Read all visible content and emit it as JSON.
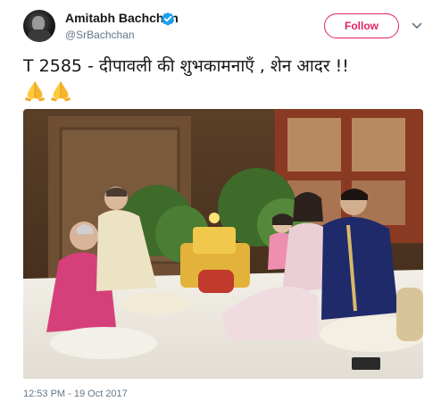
{
  "author": {
    "display_name": "Amitabh Bachchan",
    "handle": "@SrBachchan",
    "verified": true
  },
  "actions": {
    "follow_label": "Follow"
  },
  "tweet": {
    "text": "T 2585 - दीपावली की शुभकामनाएँ , शेन आदर  !!",
    "emojis": [
      "folded-hands",
      "folded-hands"
    ],
    "timestamp": "12:53 PM - 19 Oct 2017"
  },
  "colors": {
    "follow_accent": "#e0245e",
    "verified_blue": "#1da1f2",
    "muted_text": "#657786",
    "primary_text": "#14171a"
  }
}
